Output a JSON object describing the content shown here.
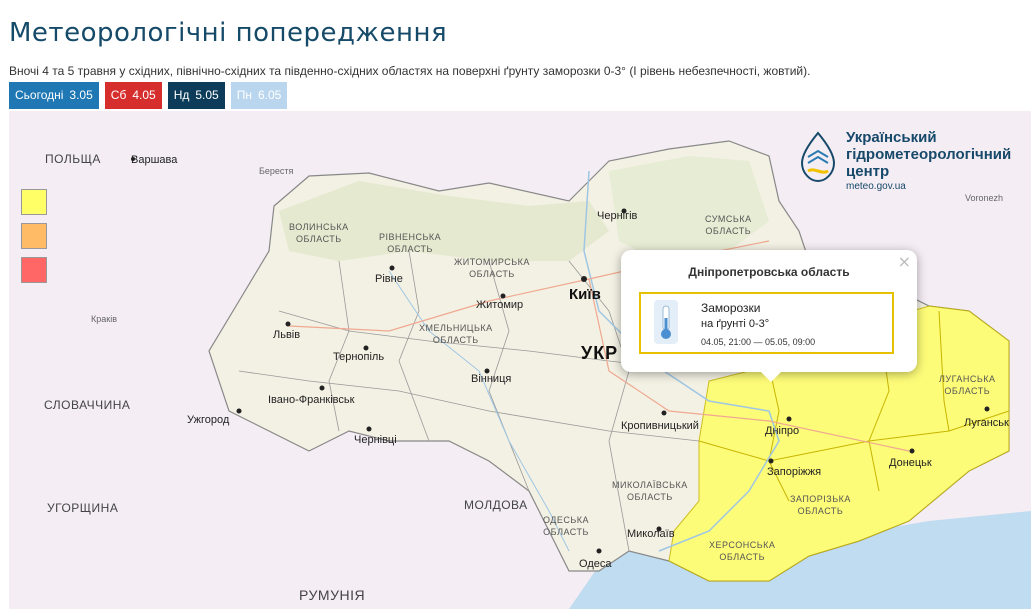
{
  "page": {
    "title": "Метеорологічні попередження",
    "description": "Вночі 4 та 5 травня у східних, північно-східних та південно-східних областях на поверхні ґрунту заморозки 0-3° (І рівень небезпечності, жовтий)."
  },
  "tabs": [
    {
      "label": "Сьогодні",
      "date": "3.05",
      "color": "#1f77b4"
    },
    {
      "label": "Сб",
      "date": "4.05",
      "color": "#d62d2d"
    },
    {
      "label": "Нд",
      "date": "5.05",
      "color": "#0c3c59"
    },
    {
      "label": "Пн",
      "date": "6.05",
      "color": "#b9d6ee"
    }
  ],
  "legend": {
    "colors": [
      "#ffff66",
      "#ffbb66",
      "#ff6666"
    ]
  },
  "logo": {
    "line1": "Український",
    "line2": "гідрометеорологічний",
    "line3": "центр",
    "url": "meteo.gov.ua"
  },
  "map": {
    "countries": {
      "poland": "ПОЛЬЩА",
      "slovakia": "СЛОВАЧЧИНА",
      "hungary": "УГОРЩИНА",
      "moldova": "МОЛДОВА",
      "romania": "РУМУНІЯ",
      "ukraine": "УКР"
    },
    "cities": {
      "warsaw": "Варшава",
      "brest": "Берестя",
      "krakow": "Краків",
      "voronezh": "Voronezh",
      "kyiv": "Київ",
      "chernihiv": "Чернігів",
      "rivne": "Рівне",
      "zhytomyr": "Житомир",
      "lviv": "Львів",
      "ternopil": "Тернопіль",
      "vinnytsia": "Вінниця",
      "ivano_frankivsk": "Івано-Франківськ",
      "uzhhorod": "Ужгород",
      "chernivtsi": "Чернівці",
      "kropyvnytskyi": "Кропивницький",
      "dnipro": "Дніпро",
      "zaporizhzhia": "Запоріжжя",
      "donetsk": "Донецьк",
      "luhansk": "Луганськ",
      "mykolaiv": "Миколаїв",
      "odesa": "Одеса"
    },
    "oblasts": {
      "volyn": [
        "ВОЛИНСЬКА",
        "ОБЛАСТЬ"
      ],
      "rivne": [
        "РІВНЕНСЬКА",
        "ОБЛАСТЬ"
      ],
      "zhytomyr": [
        "ЖИТОМИРСЬКА",
        "ОБЛАСТЬ"
      ],
      "sumy": [
        "СУМСЬКА",
        "ОБЛАСТЬ"
      ],
      "khmelnytskyi": [
        "ХМЕЛЬНИЦЬКА",
        "ОБЛАСТЬ"
      ],
      "mykolaiv": [
        "МИКОЛАЇВСЬКА",
        "ОБЛАСТЬ"
      ],
      "odesa": [
        "ОДЕСЬКА",
        "ОБЛАСТЬ"
      ],
      "zaporizhzhia": [
        "ЗАПОРІЗЬКА",
        "ОБЛАСТЬ"
      ],
      "kherson": [
        "ХЕРСОНСЬКА",
        "ОБЛАСТЬ"
      ],
      "luhansk": [
        "ЛУГАНСЬКА",
        "ОБЛАСТЬ"
      ]
    }
  },
  "popup": {
    "close": "×",
    "title": "Дніпропетровська область",
    "warning_title": "Заморозки",
    "warning_sub": "на ґрунті 0-3°",
    "warning_time": "04.05, 21:00 — 05.05, 09:00",
    "warning_color": "#e6c100"
  }
}
